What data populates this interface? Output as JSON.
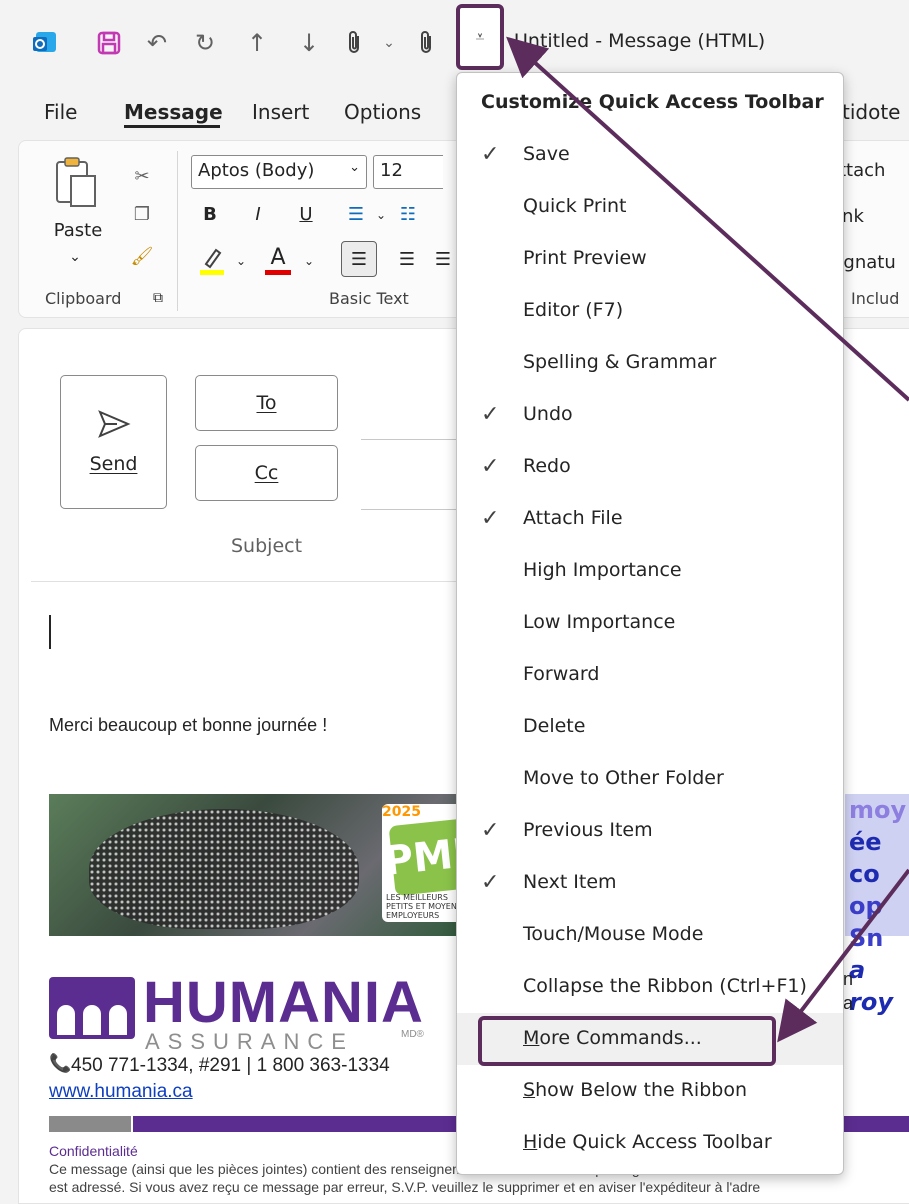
{
  "window": {
    "title": "Untitled  -  Message (HTML)"
  },
  "tabs": [
    {
      "label": "File"
    },
    {
      "label": "Message"
    },
    {
      "label": "Insert"
    },
    {
      "label": "Options"
    },
    {
      "label": "tidote"
    }
  ],
  "ribbon": {
    "paste_label": "Paste",
    "font_name": "Aptos (Body)",
    "font_size": "12",
    "bold": "B",
    "italic": "I",
    "underline": "U",
    "font_color_glyph": "A",
    "clipboard_label": "Clipboard",
    "basic_text_label": "Basic Text",
    "attach_label": "Attach",
    "link_label": "Link",
    "signature_label": "Signatu",
    "include_label": "Includ"
  },
  "compose": {
    "send_label": "Send",
    "to_label": "To",
    "cc_label": "Cc",
    "subject_label": "Subject",
    "body_text": "Merci beaucoup et bonne journée !"
  },
  "signature": {
    "badge_year": "2025",
    "badge_text": "PME",
    "badge_subtext": "LES MEILLEURS PETITS ET MOYENS EMPLOYEURS",
    "right_banner_lines": [
      "moy",
      "ée co",
      "op Sn",
      "a roy"
    ],
    "logo_word": "HUMANIA",
    "logo_sub": "ASSURANCE",
    "logo_mark_sup": "MD®",
    "phone": "450 771-1334, #291 |  1 800 363-1334",
    "website": "www.humania.ca",
    "side_letters": [
      "n",
      "a"
    ],
    "confidential_title": "Confidentialité",
    "confidential_line1": "Ce message (ainsi que les pièces jointes) contient des renseignements confidentiels ou privilégiés et est destiné se",
    "confidential_line2": "est adressé. Si vous avez reçu ce message par erreur, S.V.P. veuillez le supprimer et en aviser l'expéditeur à l'adre"
  },
  "menu": {
    "title": "Customize Quick Access Toolbar",
    "items": [
      {
        "label": "Save",
        "checked": true
      },
      {
        "label": "Quick Print",
        "checked": false
      },
      {
        "label": "Print Preview",
        "checked": false
      },
      {
        "label": "Editor (F7)",
        "checked": false
      },
      {
        "label": "Spelling & Grammar",
        "checked": false
      },
      {
        "label": "Undo",
        "checked": true
      },
      {
        "label": "Redo",
        "checked": true
      },
      {
        "label": "Attach File",
        "checked": true
      },
      {
        "label": "High Importance",
        "checked": false
      },
      {
        "label": "Low Importance",
        "checked": false
      },
      {
        "label": "Forward",
        "checked": false
      },
      {
        "label": "Delete",
        "checked": false
      },
      {
        "label": "Move to Other Folder",
        "checked": false
      },
      {
        "label": "Previous Item",
        "checked": true
      },
      {
        "label": "Next Item",
        "checked": true
      },
      {
        "label": "Touch/Mouse Mode",
        "checked": false
      },
      {
        "label": "Collapse the Ribbon (Ctrl+F1)",
        "checked": false
      },
      {
        "label": "More Commands...",
        "checked": false
      },
      {
        "label": "Show Below the Ribbon",
        "checked": false
      },
      {
        "label": "Hide Quick Access Toolbar",
        "checked": false
      }
    ],
    "check_glyph": "✓"
  },
  "colors": {
    "annotation": "#5c2d5c",
    "brand_purple": "#5c2d91",
    "save_icon": "#c239b3",
    "outlook_blue": "#0f6cbd"
  }
}
